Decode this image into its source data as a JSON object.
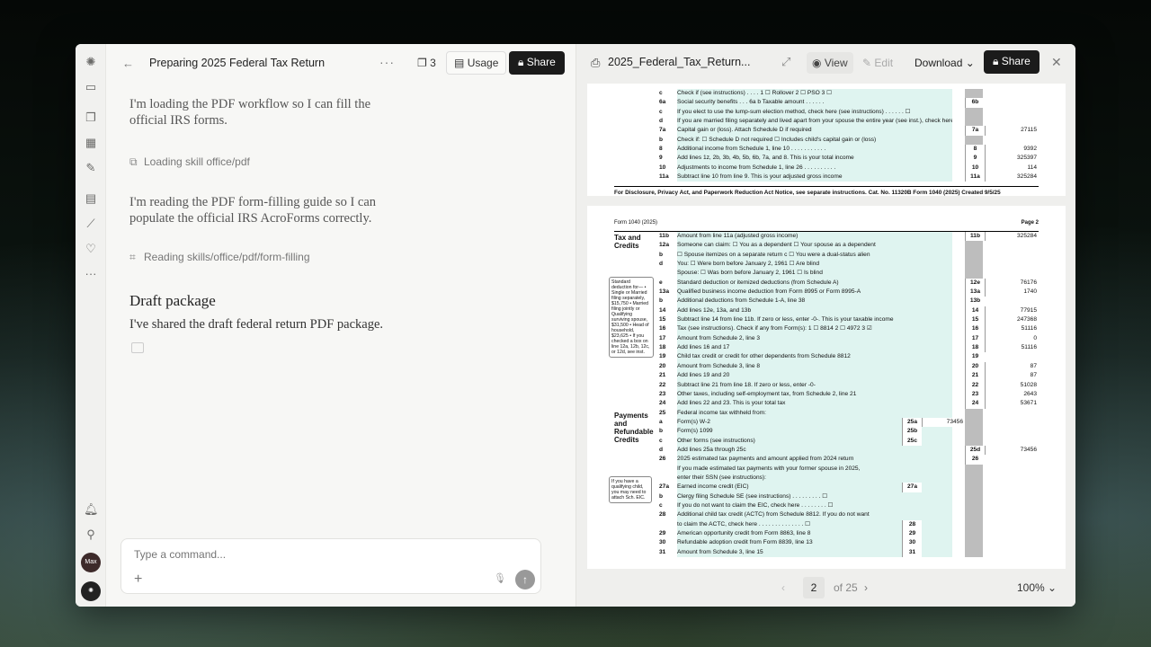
{
  "chat": {
    "back_icon": "arrow-left-icon",
    "title": "Preparing 2025 Federal Tax Return",
    "more": "···",
    "count": "3",
    "usage": "Usage",
    "share": "Share",
    "messages": {
      "m1": "I'm loading the PDF workflow so I can fill the official IRS forms.",
      "t1": "Loading skill office/pdf",
      "m2": "I'm reading the PDF form-filling guide so I can populate the official IRS AcroForms correctly.",
      "t2": "Reading skills/office/pdf/form-filling",
      "draft_heading": "Draft package",
      "draft_text": "I've shared the draft federal return PDF package."
    },
    "composer_placeholder": "Type a command..."
  },
  "rail": {
    "avatar_label": "Max"
  },
  "viewer": {
    "filename": "2025_Federal_Tax_Return...",
    "view": "View",
    "edit": "Edit",
    "download": "Download",
    "share": "Share",
    "page_current": "2",
    "page_of": "of 25",
    "zoom": "100%"
  },
  "form_p1": [
    {
      "ln": "c",
      "tx": "Check if (see instructions) . . . . 1 ☐ Rollover    2 ☐ PSO    3 ☐",
      "bx": "",
      "val": ""
    },
    {
      "ln": "6a",
      "tx": "Social security benefits . . .   6a            b  Taxable amount . . . . . .",
      "bx": "6b",
      "val": ""
    },
    {
      "ln": "c",
      "tx": "If you elect to use the lump-sum election method, check here (see instructions) . . . . . . ☐",
      "bx": "",
      "val": ""
    },
    {
      "ln": "d",
      "tx": "If you are married filing separately and lived apart from your spouse the entire year (see inst.), check here ☐",
      "bx": "",
      "val": ""
    },
    {
      "ln": "7a",
      "tx": "Capital gain or (loss). Attach Schedule D if required",
      "bx": "7a",
      "val": "27115"
    },
    {
      "ln": "b",
      "tx": "Check if: ☐ Schedule D not required   ☐ Includes child's capital gain or (loss)",
      "bx": "",
      "val": ""
    },
    {
      "ln": "8",
      "tx": "Additional income from Schedule 1, line 10 . . . . . . . . . . .",
      "bx": "8",
      "val": "9392"
    },
    {
      "ln": "9",
      "tx": "Add lines 1z, 2b, 3b, 4b, 5b, 6b, 7a, and 8. This is your total income",
      "bx": "9",
      "val": "325397"
    },
    {
      "ln": "10",
      "tx": "Adjustments to income from Schedule 1, line 26 . . . . . . . . . .",
      "bx": "10",
      "val": "114"
    },
    {
      "ln": "11a",
      "tx": "Subtract line 10 from line 9. This is your adjusted gross income",
      "bx": "11a",
      "val": "325284"
    }
  ],
  "form_p1_footer": "For Disclosure, Privacy Act, and Paperwork Reduction Act Notice, see separate instructions.     Cat. No. 11320B     Form 1040 (2025) Created 9/5/25",
  "form_p2_header_left": "Form 1040 (2025)",
  "form_p2_header_right": "Page 2",
  "section_tax": "Tax and Credits",
  "section_pay": "Payments and Refundable Credits",
  "std_note": "Standard deduction for— • Single or Married filing separately, $15,750 • Married filing jointly or Qualifying surviving spouse, $31,500 • Head of household, $23,625 • If you checked a box on line 12a, 12b, 12c, or 12d, see inst.",
  "eic_note": "If you have a qualifying child, you may need to attach Sch. EIC.",
  "form_p2": [
    {
      "ln": "11b",
      "tx": "Amount from line 11a (adjusted gross income)",
      "bx": "11b",
      "val": "325284"
    },
    {
      "ln": "12a",
      "tx": "Someone can claim:   ☐ You as a dependent   ☐ Your spouse as a dependent",
      "bx": "",
      "val": ""
    },
    {
      "ln": "b",
      "tx": "☐ Spouse itemizes on a separate return     c ☐ You were a dual-status alien",
      "bx": "",
      "val": ""
    },
    {
      "ln": "d",
      "tx": "You:   ☐ Were born before January 2, 1961    ☐ Are blind",
      "bx": "",
      "val": ""
    },
    {
      "ln": "",
      "tx": "Spouse:  ☐ Was born before January 2, 1961   ☐ Is blind",
      "bx": "",
      "val": ""
    },
    {
      "ln": "e",
      "tx": "Standard deduction or itemized deductions (from Schedule A)",
      "bx": "12e",
      "val": "76176"
    },
    {
      "ln": "13a",
      "tx": "Qualified business income deduction from Form 8995 or Form 8995-A",
      "bx": "13a",
      "val": "1740"
    },
    {
      "ln": "b",
      "tx": "Additional deductions from Schedule 1-A, line 38",
      "bx": "13b",
      "val": ""
    },
    {
      "ln": "14",
      "tx": "Add lines 12e, 13a, and 13b",
      "bx": "14",
      "val": "77915"
    },
    {
      "ln": "15",
      "tx": "Subtract line 14 from line 11b. If zero or less, enter -0-. This is your taxable income",
      "bx": "15",
      "val": "247368"
    },
    {
      "ln": "16",
      "tx": "Tax (see instructions). Check if any from Form(s):  1 ☐ 8814   2 ☐ 4972   3 ☑",
      "bx": "16",
      "val": "51116"
    },
    {
      "ln": "17",
      "tx": "Amount from Schedule 2, line 3",
      "bx": "17",
      "val": "0"
    },
    {
      "ln": "18",
      "tx": "Add lines 16 and 17",
      "bx": "18",
      "val": "51116"
    },
    {
      "ln": "19",
      "tx": "Child tax credit or credit for other dependents from Schedule 8812",
      "bx": "19",
      "val": ""
    },
    {
      "ln": "20",
      "tx": "Amount from Schedule 3, line 8",
      "bx": "20",
      "val": "87"
    },
    {
      "ln": "21",
      "tx": "Add lines 19 and 20",
      "bx": "21",
      "val": "87"
    },
    {
      "ln": "22",
      "tx": "Subtract line 21 from line 18. If zero or less, enter -0-",
      "bx": "22",
      "val": "51028"
    },
    {
      "ln": "23",
      "tx": "Other taxes, including self-employment tax, from Schedule 2, line 21",
      "bx": "23",
      "val": "2643"
    },
    {
      "ln": "24",
      "tx": "Add lines 22 and 23. This is your total tax",
      "bx": "24",
      "val": "53671"
    },
    {
      "ln": "25",
      "tx": "Federal income tax withheld from:",
      "bx": "",
      "val": ""
    },
    {
      "ln": "a",
      "tx": "Form(s) W-2",
      "cell": "25a",
      "cval": "73456",
      "bx": "",
      "val": ""
    },
    {
      "ln": "b",
      "tx": "Form(s) 1099",
      "cell": "25b",
      "cval": "",
      "bx": "",
      "val": ""
    },
    {
      "ln": "c",
      "tx": "Other forms (see instructions)",
      "cell": "25c",
      "cval": "",
      "bx": "",
      "val": ""
    },
    {
      "ln": "d",
      "tx": "Add lines 25a through 25c",
      "bx": "25d",
      "val": "73456"
    },
    {
      "ln": "26",
      "tx": "2025 estimated tax payments and amount applied from 2024 return",
      "bx": "26",
      "val": ""
    },
    {
      "ln": "",
      "tx": "If you made estimated tax payments with your former spouse in 2025,",
      "bx": "",
      "val": ""
    },
    {
      "ln": "",
      "tx": "enter their SSN (see instructions):",
      "bx": "",
      "val": ""
    },
    {
      "ln": "27a",
      "tx": "Earned income credit (EIC)",
      "cell": "27a",
      "cval": "",
      "bx": "",
      "val": ""
    },
    {
      "ln": "b",
      "tx": "Clergy filing Schedule SE (see instructions) . . . . . . . . . ☐",
      "bx": "",
      "val": ""
    },
    {
      "ln": "c",
      "tx": "If you do not want to claim the EIC, check here . . . . . . . . ☐",
      "bx": "",
      "val": ""
    },
    {
      "ln": "28",
      "tx": "Additional child tax credit (ACTC) from Schedule 8812. If you do not want",
      "bx": "",
      "val": ""
    },
    {
      "ln": "",
      "tx": "to claim the ACTC, check here . . . . . . . . . . . . . . ☐",
      "cell": "28",
      "cval": "",
      "bx": "",
      "val": ""
    },
    {
      "ln": "29",
      "tx": "American opportunity credit from Form 8863, line 8",
      "cell": "29",
      "cval": "",
      "bx": "",
      "val": ""
    },
    {
      "ln": "30",
      "tx": "Refundable adoption credit from Form 8839, line 13",
      "cell": "30",
      "cval": "",
      "bx": "",
      "val": ""
    },
    {
      "ln": "31",
      "tx": "Amount from Schedule 3, line 15",
      "cell": "31",
      "cval": "",
      "bx": "",
      "val": ""
    }
  ]
}
